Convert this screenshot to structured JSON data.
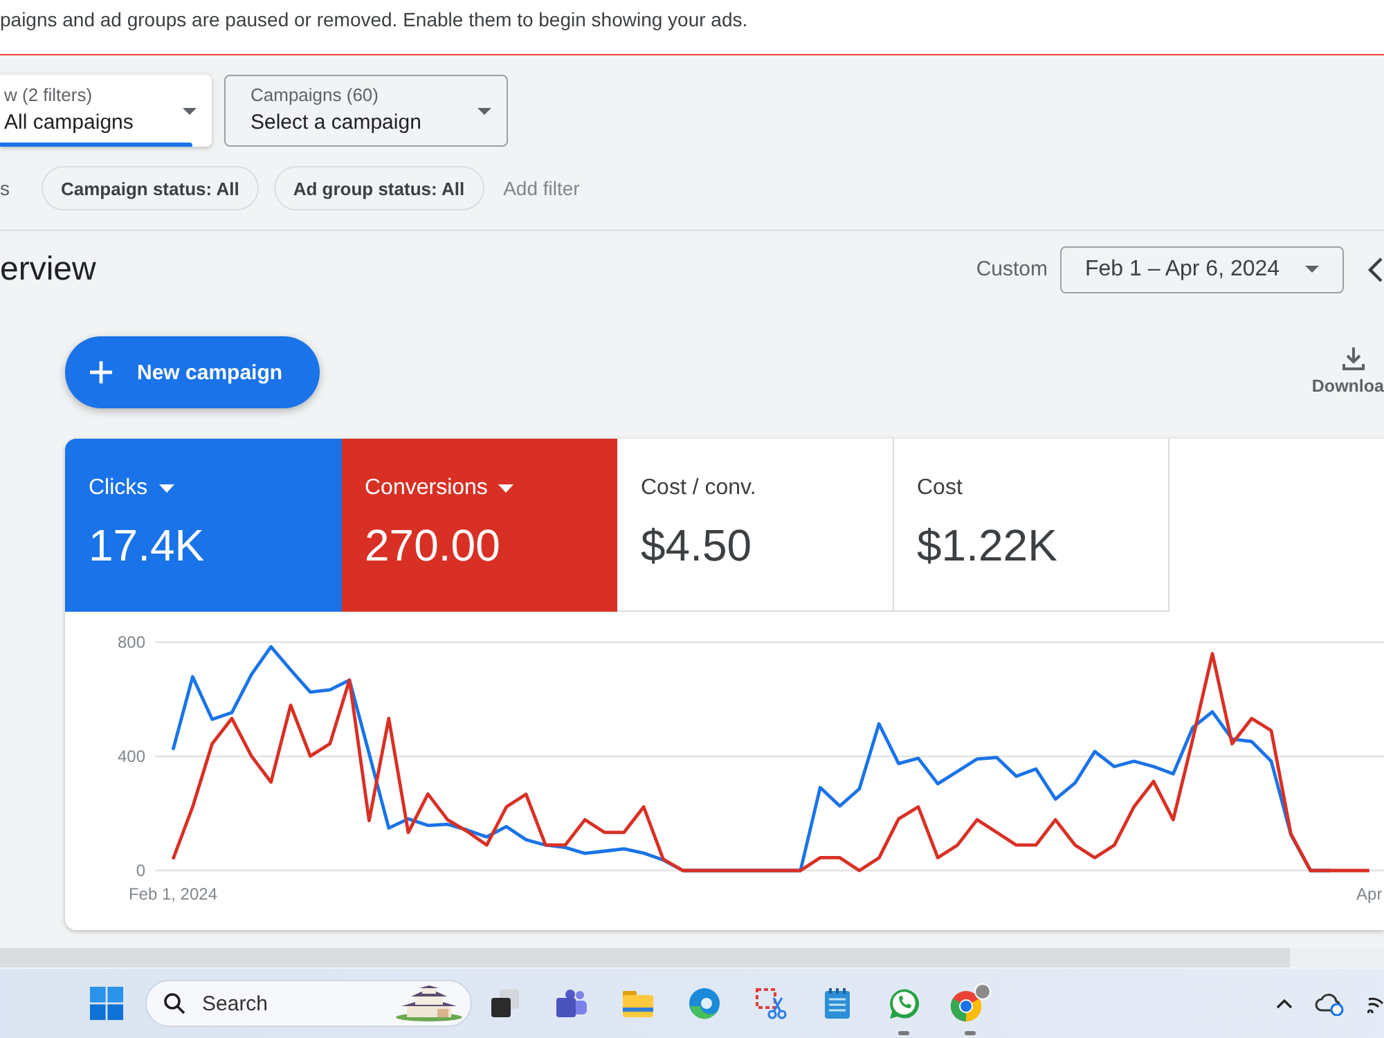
{
  "banner": {
    "message": "paigns and ad groups are paused or removed. Enable them to begin showing your ads."
  },
  "filters": {
    "view": {
      "label": "w (2 filters)",
      "value": "All campaigns"
    },
    "campaigns": {
      "label": "Campaigns (60)",
      "value": "Select a campaign"
    },
    "row_label": "s",
    "chips": [
      "Campaign status: All",
      "Ad group status: All"
    ],
    "add_filter": "Add filter"
  },
  "header": {
    "title": "erview",
    "date_label": "Custom",
    "date_range": "Feb 1 – Apr 6, 2024"
  },
  "actions": {
    "new_campaign": "New campaign",
    "download": "Downloa"
  },
  "performance_card": {
    "metrics": [
      {
        "label": "Clicks",
        "value": "17.4K",
        "selected": true,
        "color": "#1a73e8"
      },
      {
        "label": "Conversions",
        "value": "270.00",
        "selected": true,
        "color": "#d93025"
      },
      {
        "label": "Cost / conv.",
        "value": "$4.50",
        "selected": false
      },
      {
        "label": "Cost",
        "value": "$1.22K",
        "selected": false
      }
    ],
    "chart_data": {
      "type": "line",
      "x": [
        "2024-02-01",
        "2024-02-02",
        "2024-02-03",
        "2024-02-04",
        "2024-02-05",
        "2024-02-06",
        "2024-02-07",
        "2024-02-08",
        "2024-02-09",
        "2024-02-10",
        "2024-02-11",
        "2024-02-12",
        "2024-02-13",
        "2024-02-14",
        "2024-02-15",
        "2024-02-16",
        "2024-02-17",
        "2024-02-18",
        "2024-02-19",
        "2024-02-20",
        "2024-02-21",
        "2024-02-22",
        "2024-02-23",
        "2024-02-24",
        "2024-02-25",
        "2024-02-26",
        "2024-02-27",
        "2024-02-28",
        "2024-02-29",
        "2024-03-01",
        "2024-03-02",
        "2024-03-03",
        "2024-03-04",
        "2024-03-05",
        "2024-03-06",
        "2024-03-07",
        "2024-03-08",
        "2024-03-09",
        "2024-03-10",
        "2024-03-11",
        "2024-03-12",
        "2024-03-13",
        "2024-03-14",
        "2024-03-15",
        "2024-03-16",
        "2024-03-17",
        "2024-03-18",
        "2024-03-19",
        "2024-03-20",
        "2024-03-21",
        "2024-03-22",
        "2024-03-23",
        "2024-03-24",
        "2024-03-25",
        "2024-03-26",
        "2024-03-27",
        "2024-03-28",
        "2024-03-29",
        "2024-03-30",
        "2024-03-31",
        "2024-04-01",
        "2024-04-02"
      ],
      "series": [
        {
          "color": "#1a73e8",
          "values": [
            423,
            679,
            530,
            553,
            687,
            784,
            703,
            625,
            633,
            667,
            410,
            149,
            181,
            158,
            162,
            142,
            118,
            154,
            108,
            89,
            81,
            60,
            68,
            76,
            61,
            37,
            0,
            0,
            0,
            0,
            0,
            0,
            0,
            291,
            226,
            286,
            514,
            375,
            393,
            304,
            347,
            391,
            396,
            330,
            356,
            250,
            307,
            417,
            364,
            383,
            364,
            339,
            501,
            556,
            461,
            452,
            383,
            126,
            0,
            0,
            null,
            null
          ]
        },
        {
          "color": "#d93025",
          "values": [
            40,
            223,
            444,
            533,
            401,
            310,
            579,
            401,
            444,
            667,
            175,
            533,
            133,
            268,
            178,
            137,
            89,
            223,
            267,
            89,
            89,
            178,
            134,
            134,
            223,
            40,
            0,
            0,
            0,
            0,
            0,
            0,
            0,
            45,
            45,
            0,
            44,
            181,
            223,
            45,
            89,
            178,
            134,
            89,
            89,
            178,
            89,
            45,
            89,
            223,
            312,
            178,
            460,
            760,
            444,
            533,
            490,
            129,
            0,
            0,
            0,
            0
          ]
        }
      ],
      "xlim": [
        "2024-01-31T02:00",
        "2024-04-02T18:00"
      ],
      "ylim": [
        0,
        800
      ],
      "yticks": [
        0,
        400,
        800
      ],
      "xticks": [
        {
          "value": "2024-02-01",
          "label": "Feb 1, 2024"
        },
        {
          "value": "2024-04-02",
          "label": "Apr"
        }
      ],
      "grid": true
    }
  },
  "taskbar": {
    "search_placeholder": "Search",
    "apps": [
      {
        "running": false
      },
      {
        "running": false
      },
      {
        "running": false
      },
      {
        "running": false
      },
      {
        "running": false
      },
      {
        "running": false
      },
      {
        "running": true
      },
      {
        "running": true
      }
    ]
  }
}
